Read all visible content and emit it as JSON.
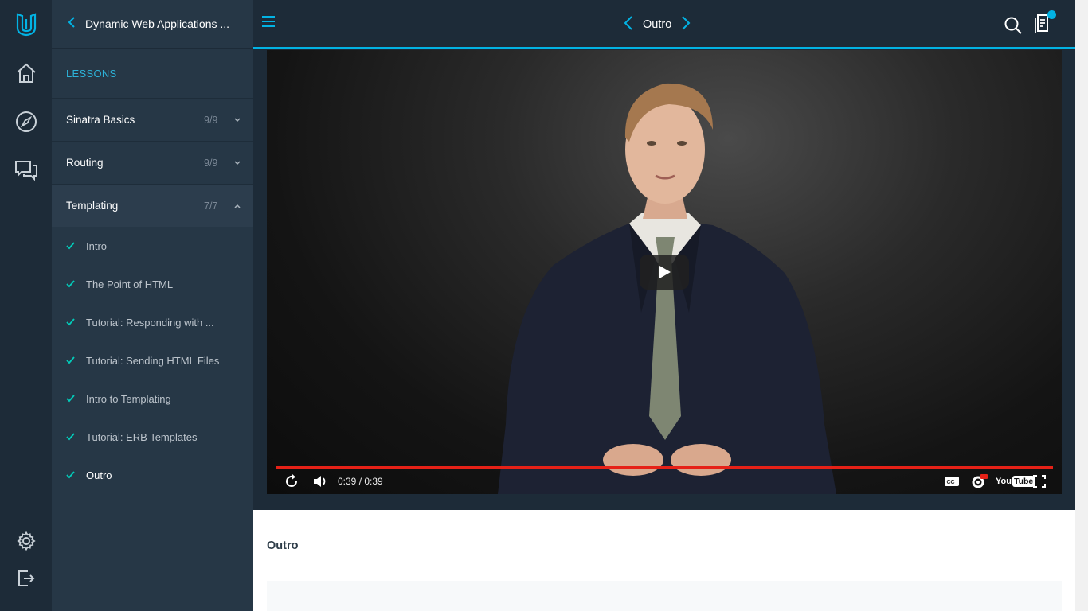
{
  "course": {
    "title": "Dynamic Web Applications ..."
  },
  "sidebar": {
    "section_label": "LESSONS",
    "lessons": [
      {
        "name": "Sinatra Basics",
        "count": "9/9",
        "expanded": false
      },
      {
        "name": "Routing",
        "count": "9/9",
        "expanded": false
      },
      {
        "name": "Templating",
        "count": "7/7",
        "expanded": true
      }
    ],
    "concepts": [
      {
        "name": "Intro",
        "completed": true
      },
      {
        "name": "The Point of HTML",
        "completed": true
      },
      {
        "name": "Tutorial: Responding with ...",
        "completed": true
      },
      {
        "name": "Tutorial: Sending HTML Files",
        "completed": true
      },
      {
        "name": "Intro to Templating",
        "completed": true
      },
      {
        "name": "Tutorial: ERB Templates",
        "completed": true
      },
      {
        "name": "Outro",
        "completed": true,
        "current": true
      }
    ]
  },
  "topbar": {
    "title": "Outro"
  },
  "video": {
    "time": "0:39 / 0:39",
    "progress": 1.0,
    "brand_you": "You",
    "brand_tube": "Tube"
  },
  "concept_title": "Outro",
  "colors": {
    "rail": "#1d2b38",
    "sidebar": "#263746",
    "accent": "#02b3e4",
    "check": "#02ccba",
    "progress": "#e62117"
  },
  "icons": {
    "rail": [
      "udacity-logo-icon",
      "home-icon",
      "compass-icon",
      "chat-icon",
      "gear-icon",
      "logout-icon"
    ],
    "topbar": [
      "menu-icon",
      "chevron-left-icon",
      "chevron-right-icon",
      "search-icon",
      "notes-icon"
    ],
    "player": [
      "play-icon",
      "replay-icon",
      "volume-icon",
      "captions-icon",
      "settings-hd-icon",
      "youtube-logo",
      "fullscreen-icon"
    ]
  }
}
